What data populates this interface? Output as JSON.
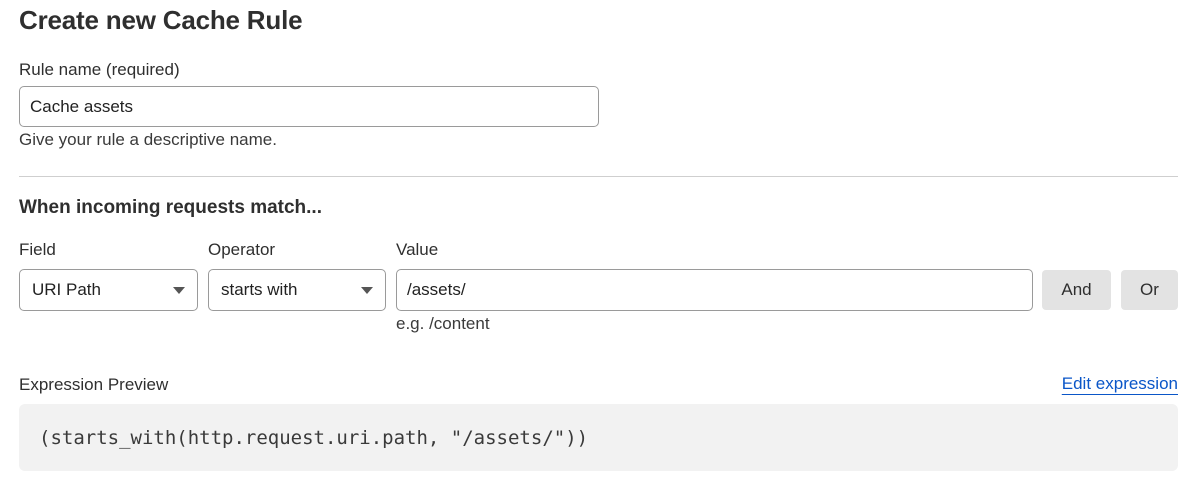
{
  "page": {
    "title": "Create new Cache Rule"
  },
  "rule_name": {
    "label": "Rule name (required)",
    "value": "Cache assets",
    "help": "Give your rule a descriptive name."
  },
  "match": {
    "section_title": "When incoming requests match...",
    "field_label": "Field",
    "operator_label": "Operator",
    "value_label": "Value",
    "field_value": "URI Path",
    "operator_value": "starts with",
    "value_value": "/assets/",
    "value_hint": "e.g. /content",
    "and_label": "And",
    "or_label": "Or"
  },
  "expression": {
    "label": "Expression Preview",
    "edit_link": "Edit expression",
    "code": "(starts_with(http.request.uri.path, \"/assets/\"))"
  },
  "colors": {
    "link": "#0a56c8",
    "button_bg": "#e3e3e3",
    "code_bg": "#f2f2f2",
    "divider": "#cfcfcf"
  }
}
